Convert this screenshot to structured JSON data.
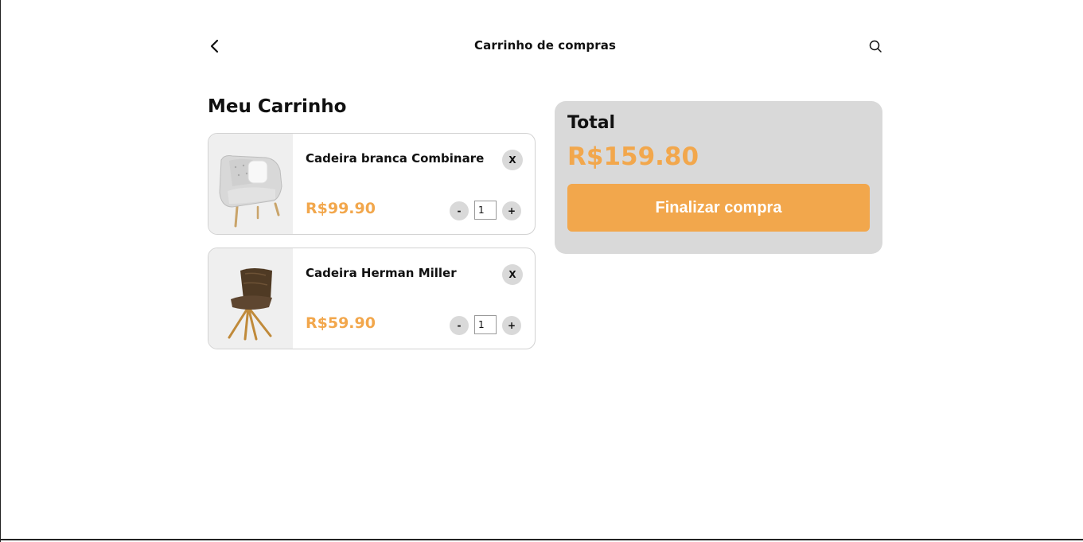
{
  "header": {
    "title": "Carrinho de compras",
    "back_icon": "chevron-left-icon",
    "search_icon": "search-icon"
  },
  "cart": {
    "heading": "Meu Carrinho",
    "items": [
      {
        "name": "Cadeira branca Combinare",
        "price": "R$99.90",
        "quantity": "1",
        "remove_label": "X",
        "minus_label": "-",
        "plus_label": "+"
      },
      {
        "name": "Cadeira Herman Miller",
        "price": "R$59.90",
        "quantity": "1",
        "remove_label": "X",
        "minus_label": "-",
        "plus_label": "+"
      }
    ]
  },
  "summary": {
    "total_label": "Total",
    "total_value": "R$159.80",
    "checkout_label": "Finalizar compra"
  },
  "colors": {
    "accent": "#f2a74c",
    "panel": "#d9d9d9",
    "text": "#111111"
  }
}
